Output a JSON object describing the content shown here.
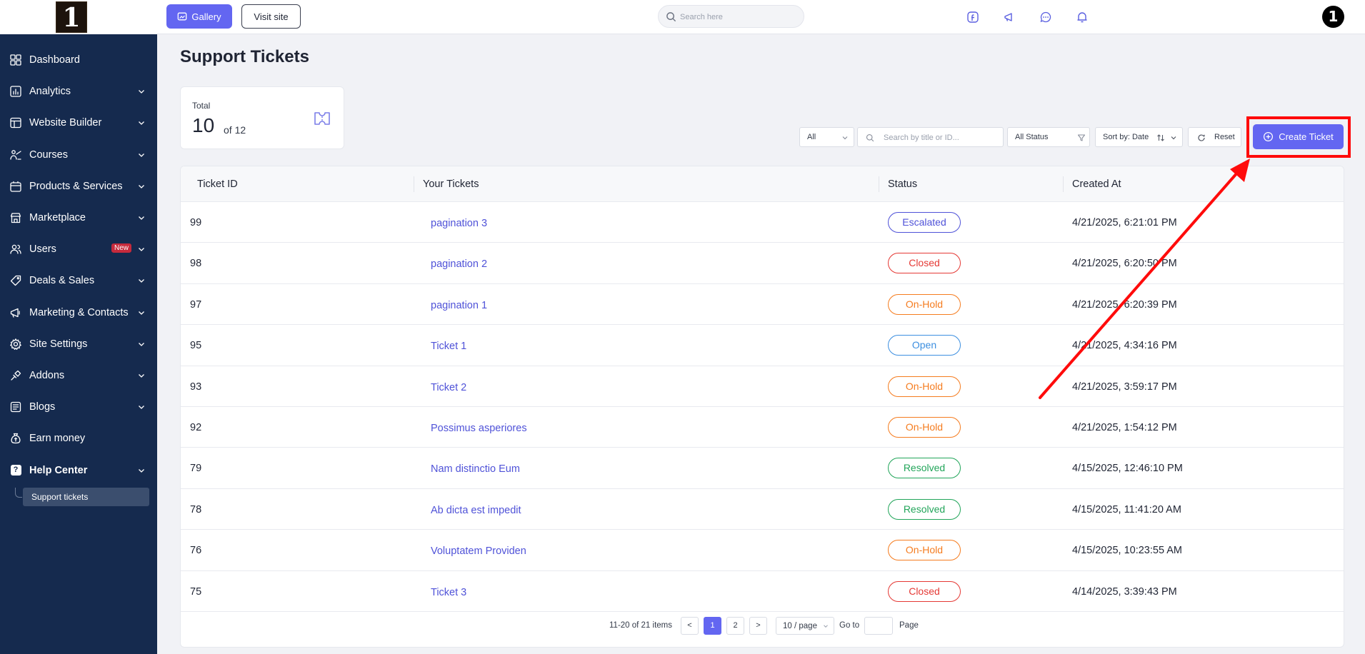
{
  "sidebar": {
    "logo_text": "1",
    "items": [
      {
        "label": "Dashboard",
        "icon": "dashboard-icon",
        "chevron": false
      },
      {
        "label": "Analytics",
        "icon": "analytics-icon",
        "chevron": true
      },
      {
        "label": "Website Builder",
        "icon": "website-builder-icon",
        "chevron": true
      },
      {
        "label": "Courses",
        "icon": "courses-icon",
        "chevron": true
      },
      {
        "label": "Products & Services",
        "icon": "products-icon",
        "chevron": true
      },
      {
        "label": "Marketplace",
        "icon": "marketplace-icon",
        "chevron": true
      },
      {
        "label": "Users",
        "icon": "users-icon",
        "chevron": true,
        "badge": "New"
      },
      {
        "label": "Deals & Sales",
        "icon": "deals-icon",
        "chevron": true
      },
      {
        "label": "Marketing & Contacts",
        "icon": "megaphone-icon",
        "chevron": true
      },
      {
        "label": "Site Settings",
        "icon": "settings-icon",
        "chevron": true
      },
      {
        "label": "Addons",
        "icon": "addons-icon",
        "chevron": true
      },
      {
        "label": "Blogs",
        "icon": "blogs-icon",
        "chevron": true
      },
      {
        "label": "Earn money",
        "icon": "money-bag-icon",
        "chevron": false
      },
      {
        "label": "Help Center",
        "icon": "help-icon",
        "chevron": true,
        "active": true
      }
    ],
    "sub_item": "Support tickets"
  },
  "topbar": {
    "gallery_label": "Gallery",
    "visit_label": "Visit site",
    "search_placeholder": "Search here",
    "avatar_text": "1"
  },
  "page": {
    "title": "Support Tickets",
    "stat_label": "Total",
    "stat_value": "10",
    "stat_of": "of 12"
  },
  "filters": {
    "type_value": "All",
    "search_placeholder": "Search by title or ID...",
    "status_value": "All Status",
    "sort_value": "Sort by: Date",
    "reset_label": "Reset",
    "create_label": "Create Ticket"
  },
  "table": {
    "columns": [
      "Ticket ID",
      "Your Tickets",
      "Status",
      "Created At"
    ],
    "rows": [
      {
        "id": "99",
        "title": "pagination 3",
        "status": "Escalated",
        "created": "4/21/2025, 6:21:01 PM"
      },
      {
        "id": "98",
        "title": "pagination 2",
        "status": "Closed",
        "created": "4/21/2025, 6:20:50 PM"
      },
      {
        "id": "97",
        "title": "pagination 1",
        "status": "On-Hold",
        "created": "4/21/2025, 6:20:39 PM"
      },
      {
        "id": "95",
        "title": "Ticket 1",
        "status": "Open",
        "created": "4/21/2025, 4:34:16 PM"
      },
      {
        "id": "93",
        "title": "Ticket 2",
        "status": "On-Hold",
        "created": "4/21/2025, 3:59:17 PM"
      },
      {
        "id": "92",
        "title": "Possimus asperiores",
        "status": "On-Hold",
        "created": "4/21/2025, 1:54:12 PM"
      },
      {
        "id": "79",
        "title": "Nam distinctio Eum",
        "status": "Resolved",
        "created": "4/15/2025, 12:46:10 PM"
      },
      {
        "id": "78",
        "title": "Ab dicta est impedit",
        "status": "Resolved",
        "created": "4/15/2025, 11:41:20 AM"
      },
      {
        "id": "76",
        "title": "Voluptatem Providen",
        "status": "On-Hold",
        "created": "4/15/2025, 10:23:55 AM"
      },
      {
        "id": "75",
        "title": "Ticket 3",
        "status": "Closed",
        "created": "4/14/2025, 3:39:43 PM"
      }
    ]
  },
  "status_colors": {
    "Escalated": "#4f52d8",
    "Closed": "#e53935",
    "On-Hold": "#f57c1f",
    "Open": "#3d8fe0",
    "Resolved": "#22a55a"
  },
  "pagination": {
    "range_text": "11-20 of 21 items",
    "prev": "<",
    "pages": [
      "1",
      "2"
    ],
    "next": ">",
    "page_size": "10 / page",
    "goto_label": "Go to",
    "page_label": "Page"
  },
  "colors": {
    "accent": "#6366f1",
    "sidebar_bg": "#152a4e",
    "annotation_red": "#ff0b0b"
  }
}
